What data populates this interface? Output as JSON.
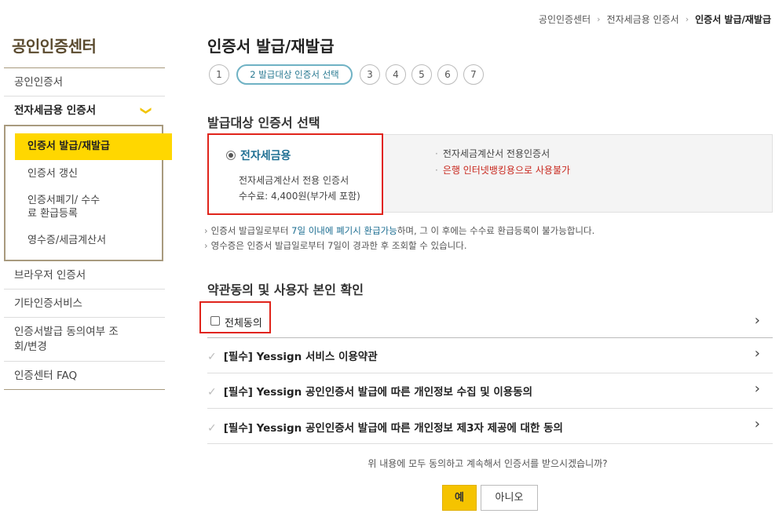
{
  "breadcrumb": [
    "공인인증센터",
    "전자세금용 인증서",
    "인증서 발급/재발급"
  ],
  "sidebar": {
    "title": "공인인증센터",
    "items": [
      {
        "label": "공인인증서"
      },
      {
        "label": "전자세금용 인증서"
      },
      {
        "label": "브라우저 인증서"
      },
      {
        "label": "기타인증서비스"
      },
      {
        "label": "인증서발급 동의여부 조회/변경"
      },
      {
        "label": "인증센터 FAQ"
      }
    ],
    "sub_items": [
      {
        "label": "인증서 발급/재발급"
      },
      {
        "label": "인증서 갱신"
      },
      {
        "label": "인증서폐기/ 수수료 환급등록"
      },
      {
        "label": "영수증/세금계산서"
      }
    ]
  },
  "main": {
    "title": "인증서 발급/재발급",
    "steps": [
      "1",
      "2 발급대상 인증서 선택",
      "3",
      "4",
      "5",
      "6",
      "7"
    ],
    "cert_section_title": "발급대상 인증서 선택",
    "cert": {
      "name": "전자세금용",
      "desc": "전자세금계산서 전용 인증서",
      "fee": "수수료: 4,400원(부가세 포함)",
      "info1": "전자세금계산서 전용인증서",
      "info2": "은행 인터넷뱅킹용으로 사용불가"
    },
    "notes": {
      "n1_a": "인증서 발급일로부터 ",
      "n1_b": "7일 이내에 폐기시 환급가능",
      "n1_c": "하며, 그 이 후에는 수수료 환급등록이 불가능합니다.",
      "n2": "영수증은 인증서 발급일로부터 7일이 경과한 후 조회할 수 있습니다."
    },
    "terms_section_title": "약관동의 및 사용자 본인 확인",
    "agree_all": "전체동의",
    "terms": [
      "[필수] Yessign 서비스 이용약관",
      "[필수] Yessign 공인인증서 발급에 따른 개인정보 수집 및 이용동의",
      "[필수] Yessign 공인인증서 발급에 따른 개인정보 제3자 제공에 대한 동의"
    ],
    "question": "위 내용에 모두 동의하고 계속해서 인증서를 받으시겠습니까?",
    "yes_label": "예",
    "no_label": "아니오"
  },
  "icons": {
    "breadcrumb_sep": "›",
    "chevron_down": "❯",
    "row_chevron": "›",
    "check": "✓",
    "gt": "›",
    "bullet": "·"
  },
  "colors": {
    "accent_yellow": "#ffd700",
    "highlight_red": "#e0241b",
    "link_blue": "#1d6e92"
  }
}
